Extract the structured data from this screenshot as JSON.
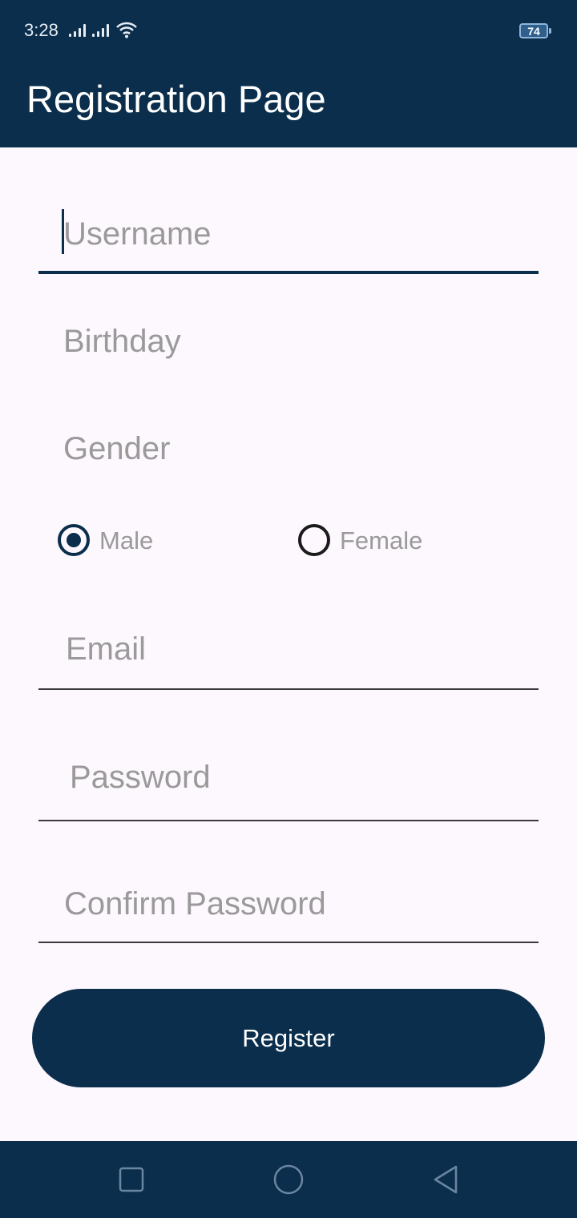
{
  "status_bar": {
    "time": "3:28",
    "battery_level": "74",
    "icons": [
      "signal-icon",
      "signal-icon",
      "wifi-icon",
      "battery-icon"
    ]
  },
  "app_bar": {
    "title": "Registration Page"
  },
  "form": {
    "username": {
      "placeholder": "Username",
      "value": ""
    },
    "birthday": {
      "placeholder": "Birthday"
    },
    "gender": {
      "label": "Gender",
      "options": [
        {
          "label": "Male",
          "selected": true
        },
        {
          "label": "Female",
          "selected": false
        }
      ]
    },
    "email": {
      "placeholder": "Email",
      "value": ""
    },
    "password": {
      "placeholder": "Password",
      "value": ""
    },
    "confirm_password": {
      "placeholder": "Confirm Password",
      "value": ""
    },
    "register_label": "Register"
  },
  "nav_bar": {
    "icons": [
      "recents-square-icon",
      "home-circle-icon",
      "back-triangle-icon"
    ]
  },
  "colors": {
    "primary": "#0b2e4c",
    "background": "#fdf8fd",
    "placeholder": "#9a9a9a"
  }
}
